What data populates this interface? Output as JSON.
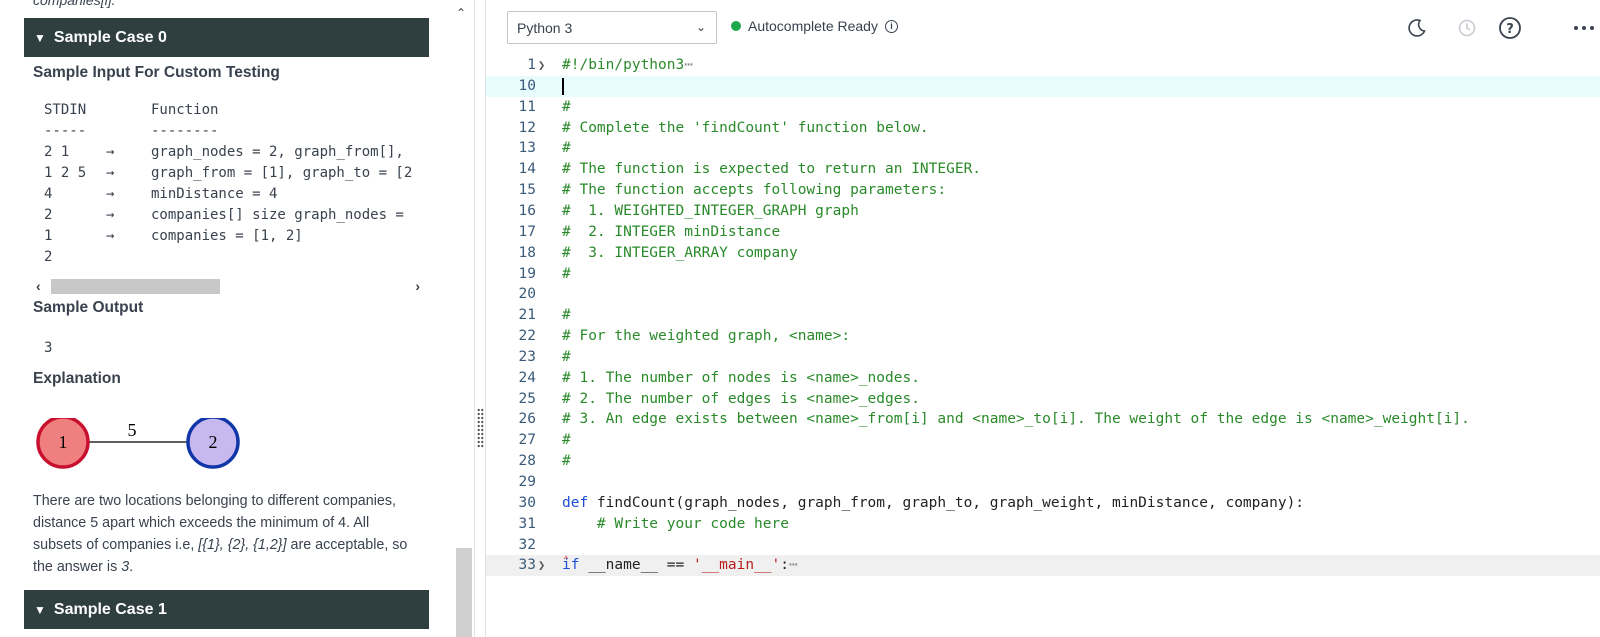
{
  "left": {
    "clipped_top_text": "companies[i].",
    "sample_case_0": "Sample Case 0",
    "sample_input_title": "Sample Input For Custom Testing",
    "stdin_header": "STDIN",
    "function_header": "Function",
    "stdin_dashes": "-----",
    "function_dashes": "--------",
    "rows": [
      {
        "stdin": "2 1",
        "arrow": "→",
        "func": "graph_nodes = 2, graph_from[],"
      },
      {
        "stdin": "1 2 5",
        "arrow": "→",
        "func": "graph_from = [1], graph_to = [2"
      },
      {
        "stdin": "4",
        "arrow": "→",
        "func": "minDistance = 4"
      },
      {
        "stdin": "2",
        "arrow": "→",
        "func": "companies[] size graph_nodes ="
      },
      {
        "stdin": "1",
        "arrow": "→",
        "func": "companies = [1, 2]"
      },
      {
        "stdin": "2",
        "arrow": "",
        "func": ""
      }
    ],
    "sample_output_title": "Sample Output",
    "sample_output_value": "3",
    "explanation_title": "Explanation",
    "graph": {
      "node1": "1",
      "node2": "2",
      "edge_weight": "5",
      "node1_color": "#f08080",
      "node2_color": "#c8b8f0"
    },
    "explanation_p1": "There are two locations belonging to different companies, distance 5 apart which exceeds the minimum of 4. All subsets of companies i.e, ",
    "explanation_sets": "[{1}, {2}, {1,2}]",
    "explanation_p2": " are acceptable, so the answer is ",
    "explanation_answer": "3",
    "explanation_end": ".",
    "sample_case_1": "Sample Case 1"
  },
  "header": {
    "language": "Python 3",
    "autocomplete": "Autocomplete Ready",
    "status_color": "#1ba94c"
  },
  "code_lines": [
    {
      "n": "1",
      "text": "#!/bin/python3",
      "cls": "cm"
    },
    {
      "n": "10",
      "text": "",
      "cls": "txt"
    },
    {
      "n": "11",
      "text": "#",
      "cls": "cm"
    },
    {
      "n": "12",
      "text": "# Complete the 'findCount' function below.",
      "cls": "cm"
    },
    {
      "n": "13",
      "text": "#",
      "cls": "cm"
    },
    {
      "n": "14",
      "text": "# The function is expected to return an INTEGER.",
      "cls": "cm"
    },
    {
      "n": "15",
      "text": "# The function accepts following parameters:",
      "cls": "cm"
    },
    {
      "n": "16",
      "text": "#  1. WEIGHTED_INTEGER_GRAPH graph",
      "cls": "cm"
    },
    {
      "n": "17",
      "text": "#  2. INTEGER minDistance",
      "cls": "cm"
    },
    {
      "n": "18",
      "text": "#  3. INTEGER_ARRAY company",
      "cls": "cm"
    },
    {
      "n": "19",
      "text": "#",
      "cls": "cm"
    },
    {
      "n": "20",
      "text": "",
      "cls": "txt"
    },
    {
      "n": "21",
      "text": "#",
      "cls": "cm"
    },
    {
      "n": "22",
      "text": "# For the weighted graph, <name>:",
      "cls": "cm"
    },
    {
      "n": "23",
      "text": "#",
      "cls": "cm"
    },
    {
      "n": "24",
      "text": "# 1. The number of nodes is <name>_nodes.",
      "cls": "cm"
    },
    {
      "n": "25",
      "text": "# 2. The number of edges is <name>_edges.",
      "cls": "cm"
    },
    {
      "n": "26",
      "text": "# 3. An edge exists between <name>_from[i] and <name>_to[i]. The weight of the edge is <name>_weight[i].",
      "cls": "cm"
    },
    {
      "n": "27",
      "text": "#",
      "cls": "cm"
    },
    {
      "n": "28",
      "text": "#",
      "cls": "cm"
    },
    {
      "n": "29",
      "text": "",
      "cls": "txt"
    },
    {
      "n": "30",
      "text": "def",
      "cls": "kw",
      "rest": " findCount(graph_nodes, graph_from, graph_to, graph_weight, minDistance, company):"
    },
    {
      "n": "31",
      "text": "    # Write your code here",
      "cls": "cm"
    },
    {
      "n": "32",
      "text": "",
      "cls": "txt"
    },
    {
      "n": "33",
      "text": "if",
      "cls": "kw",
      "rest": " __name__ == ",
      "str": "'__main__'",
      "tail": ":"
    }
  ],
  "fold_ellipsis": "⋯"
}
